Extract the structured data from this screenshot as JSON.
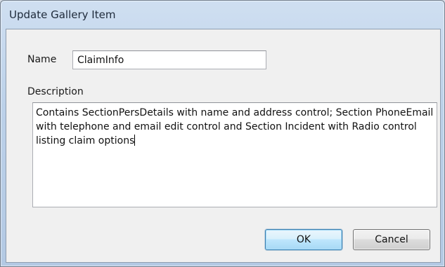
{
  "window": {
    "title": "Update Gallery Item"
  },
  "form": {
    "name_label": "Name",
    "name_value": "ClaimInfo",
    "description_label": "Description",
    "description_value": "Contains SectionPersDetails with name and address control; Section PhoneEmail with telephone and email edit control and Section Incident with Radio control listing claim options"
  },
  "buttons": {
    "ok_label": "OK",
    "cancel_label": "Cancel"
  },
  "colors": {
    "titlebar": "#bcd1e9",
    "client_background": "#f0f0f0",
    "default_button_accent": "#3c7fb1"
  }
}
